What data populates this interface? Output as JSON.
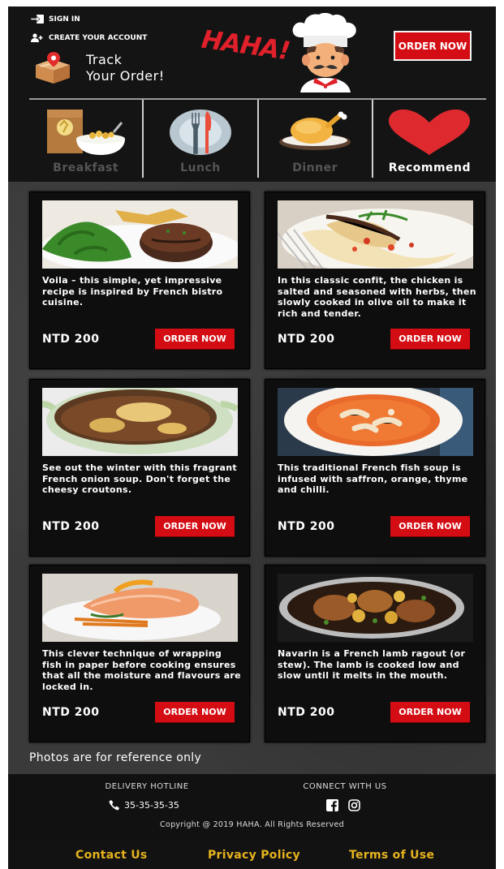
{
  "header": {
    "sign_in": "SIGN IN",
    "create_account": "CREATE YOUR ACCOUNT",
    "track_line1": "Track",
    "track_line2": "Your Order!",
    "logo": "HAHA!",
    "order_now": "ORDER NOW"
  },
  "categories": [
    {
      "label": "Breakfast",
      "icon": "breakfast-icon",
      "active": false
    },
    {
      "label": "Lunch",
      "icon": "plate-cutlery-icon",
      "active": false
    },
    {
      "label": "Dinner",
      "icon": "roast-chicken-icon",
      "active": false
    },
    {
      "label": "Recommend",
      "icon": "heart-icon",
      "active": true
    }
  ],
  "dishes": [
    {
      "desc": "Voila – this simple, yet impressive recipe is inspired by French bistro cuisine.",
      "price": "NTD 200",
      "button": "ORDER NOW",
      "image": "steak-salad"
    },
    {
      "desc": "In this classic confit, the chicken is salted and seasoned with herbs, then slowly cooked in olive oil to make it rich and tender.",
      "price": "NTD 200",
      "button": "ORDER NOW",
      "image": "chicken-confit"
    },
    {
      "desc": "See out the winter with this fragrant French onion soup. Don't forget the cheesy croutons.",
      "price": "NTD 200",
      "button": "ORDER NOW",
      "image": "onion-soup"
    },
    {
      "desc": "This traditional French fish soup is infused with saffron, orange, thyme and chilli.",
      "price": "NTD 200",
      "button": "ORDER NOW",
      "image": "fish-soup"
    },
    {
      "desc": "This clever technique of wrapping fish in paper before cooking ensures that all the moisture and flavours are locked in.",
      "price": "NTD 200",
      "button": "ORDER NOW",
      "image": "salmon"
    },
    {
      "desc": "Navarin is a French lamb ragout (or stew). The lamb is cooked low and slow until it melts in the mouth.",
      "price": "NTD 200",
      "button": "ORDER NOW",
      "image": "lamb-stew"
    }
  ],
  "note": "Photos are for reference only",
  "footer": {
    "hotline_title": "DELIVERY HOTLINE",
    "phone": "35-35-35-35",
    "connect_title": "CONNECT WITH US",
    "copyright": "Copyright @ 2019 HAHA. All Rights Reserved",
    "links": [
      "Contact Us",
      "Privacy Policy",
      "Terms of Use"
    ]
  },
  "colors": {
    "accent": "#d40c13",
    "link": "#e6b31e",
    "header_bg": "#141414"
  }
}
